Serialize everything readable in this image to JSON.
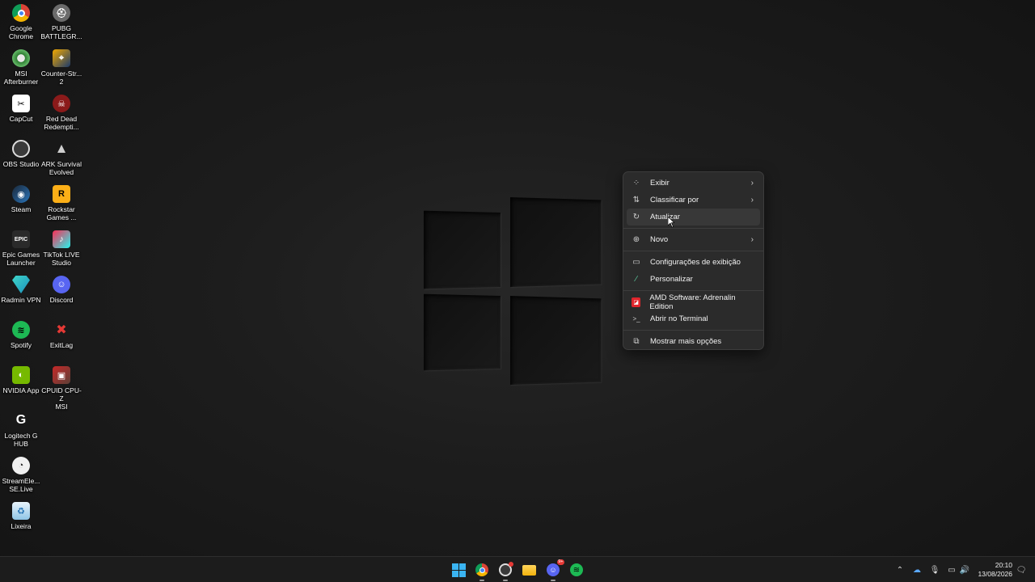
{
  "desktop": {
    "icons": [
      {
        "label": "Google\nChrome",
        "icon": "chrome-icon"
      },
      {
        "label": "PUBG\nBATTLEGR...",
        "icon": "pubg-icon"
      },
      {
        "label": "MSI\nAfterburner",
        "icon": "msi-afterburner-icon"
      },
      {
        "label": "Counter-Str...\n2",
        "icon": "counter-strike-icon"
      },
      {
        "label": "CapCut",
        "icon": "capcut-icon"
      },
      {
        "label": "Red Dead\nRedempti...",
        "icon": "red-dead-icon"
      },
      {
        "label": "OBS Studio",
        "icon": "obs-icon"
      },
      {
        "label": "ARK Survival\nEvolved",
        "icon": "ark-icon"
      },
      {
        "label": "Steam",
        "icon": "steam-icon"
      },
      {
        "label": "Rockstar\nGames ...",
        "icon": "rockstar-icon"
      },
      {
        "label": "Epic Games\nLauncher",
        "icon": "epic-games-icon"
      },
      {
        "label": "TikTok LIVE\nStudio",
        "icon": "tiktok-icon"
      },
      {
        "label": "Radmin VPN",
        "icon": "radmin-vpn-icon"
      },
      {
        "label": "Discord",
        "icon": "discord-icon"
      },
      {
        "label": "Spotify",
        "icon": "spotify-icon"
      },
      {
        "label": "ExitLag",
        "icon": "exitlag-icon"
      },
      {
        "label": "NVIDIA App",
        "icon": "nvidia-icon"
      },
      {
        "label": "CPUID CPU-Z\nMSI",
        "icon": "cpuz-icon"
      },
      {
        "label": "Logitech G\nHUB",
        "icon": "logitech-icon"
      },
      {
        "label": "StreamEle...\nSE.Live",
        "icon": "streamelements-icon"
      },
      {
        "label": "Lixeira",
        "icon": "recycle-bin-icon"
      }
    ]
  },
  "context_menu": {
    "items": [
      {
        "label": "Exibir",
        "icon": "grid-icon",
        "submenu": true
      },
      {
        "label": "Classificar por",
        "icon": "sort-icon",
        "submenu": true
      },
      {
        "label": "Atualizar",
        "icon": "refresh-icon",
        "submenu": false
      },
      {
        "label": "Novo",
        "icon": "plus-circle-icon",
        "submenu": true
      },
      {
        "label": "Configurações de exibição",
        "icon": "display-icon",
        "submenu": false
      },
      {
        "label": "Personalizar",
        "icon": "brush-icon",
        "submenu": false
      },
      {
        "label": "AMD Software: Adrenalin Edition",
        "icon": "amd-icon",
        "submenu": false
      },
      {
        "label": "Abrir no Terminal",
        "icon": "terminal-icon",
        "submenu": false
      },
      {
        "label": "Mostrar mais opções",
        "icon": "more-options-icon",
        "submenu": false
      }
    ],
    "arrow_glyph": "›"
  },
  "taskbar": {
    "apps": [
      "start-icon",
      "chrome-icon",
      "obs-icon",
      "file-explorer-icon",
      "discord-icon",
      "spotify-icon"
    ],
    "discord_badge": "9+",
    "tray": [
      "chevron-up-icon",
      "onedrive-icon",
      "microphone-icon",
      "network-icon",
      "volume-icon"
    ],
    "time": "20:10",
    "date": "13/08/2026"
  },
  "colors": {
    "chrome": "#4285f4",
    "spotify": "#1db954",
    "discord": "#5865f2",
    "amd": "#e0252c"
  }
}
